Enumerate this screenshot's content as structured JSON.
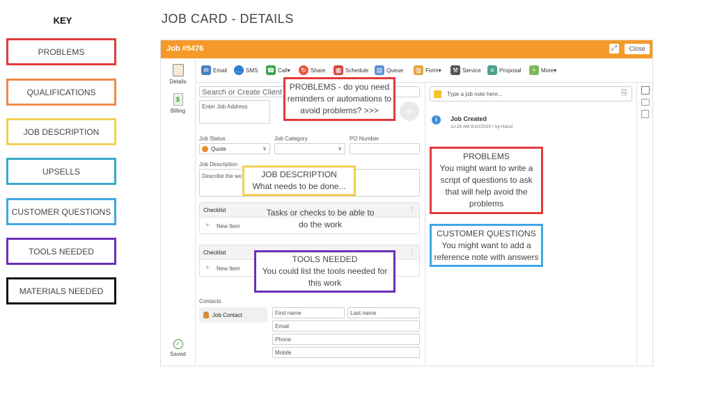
{
  "key": {
    "title": "KEY",
    "items": [
      {
        "label": "PROBLEMS",
        "color": "#e23b3b"
      },
      {
        "label": "QUALIFICATIONS",
        "color": "#f08a4b"
      },
      {
        "label": "JOB DESCRIPTION",
        "color": "#f2d152"
      },
      {
        "label": "UPSELLS",
        "color": "#3aa9c9"
      },
      {
        "label": "CUSTOMER QUESTIONS",
        "color": "#3fa7e6"
      },
      {
        "label": "TOOLS NEEDED",
        "color": "#6a2fb7"
      },
      {
        "label": "MATERIALS NEEDED",
        "color": "#111111"
      }
    ]
  },
  "page_title": "JOB CARD - DETAILS",
  "app": {
    "job_number": "Job #5476",
    "close_label": "Close",
    "nav": {
      "details": "Details",
      "billing": "Billing",
      "saved": "Saved"
    },
    "toolbar": {
      "email": "Email",
      "sms": "SMS",
      "call": "Call▾",
      "share": "Share",
      "schedule": "Schedule",
      "queue": "Queue",
      "form": "Form▾",
      "service": "Service",
      "proposal": "Proposal",
      "more": "More▾"
    },
    "search_placeholder": "Search or Create Client",
    "address_placeholder": "Enter Job Address",
    "job_status_label": "Job Status",
    "job_status_value": "Quote",
    "job_category_label": "Job Category",
    "po_number_label": "PO Number",
    "job_description_label": "Job Description",
    "job_description_placeholder": "Describe the wo",
    "checklist1_title": "Checklist",
    "checklist1_new": "New Item",
    "checklist2_title": "Checklist",
    "checklist2_new": "New Item",
    "contacts_label": "Contacts",
    "job_contact": "Job Contact",
    "first_name": "First name",
    "last_name": "Last name",
    "email": "Email",
    "phone": "Phone",
    "mobile": "Mobile",
    "note_placeholder": "Type a job note here...",
    "activity_title": "Job Created",
    "activity_meta": "10:26 AM 8/10/2025 •  by Hazel"
  },
  "annotations": {
    "problems_top": {
      "l1": "PROBLEMS - do you need",
      "l2": "reminders or automations to",
      "l3": "avoid problems? >>>"
    },
    "job_desc": {
      "l1": "JOB DESCRIPTION",
      "l2": "What needs to be done..."
    },
    "tasks": {
      "l1": "Tasks or checks to be able to",
      "l2": "do the work"
    },
    "tools": {
      "l1": "TOOLS NEEDED",
      "l2": "You could list the tools needed for",
      "l3": "this work"
    },
    "problems_right": {
      "l1": "PROBLEMS",
      "l2": "You might want to write a",
      "l3": "script of questions to ask",
      "l4": "that will help avoid the",
      "l5": "problems"
    },
    "customer_q": {
      "l1": "CUSTOMER QUESTIONS",
      "l2": "You might want to add a",
      "l3": "reference note with answers"
    }
  }
}
